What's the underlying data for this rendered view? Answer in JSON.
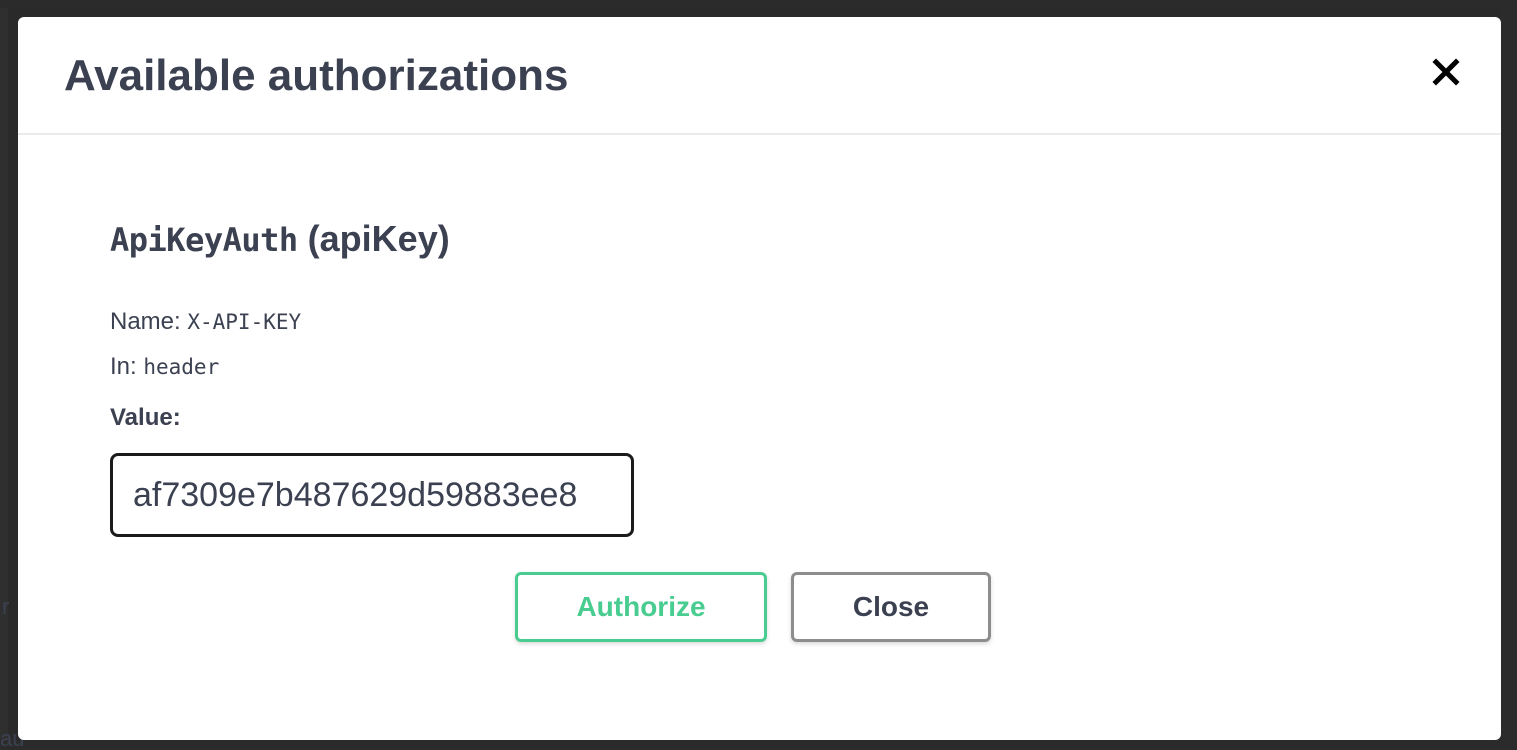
{
  "modal": {
    "title": "Available authorizations",
    "close_icon": "close-icon"
  },
  "auth": {
    "scheme_name": "ApiKeyAuth",
    "scheme_type": "(apiKey)",
    "name_label": "Name:",
    "name_value": "X-API-KEY",
    "in_label": "In:",
    "in_value": "header",
    "value_label": "Value:",
    "value_input": "af7309e7b487629d59883ee8"
  },
  "buttons": {
    "authorize": "Authorize",
    "close": "Close"
  },
  "background": {
    "peek_text_bottom": "au",
    "peek_text_mid": "r"
  },
  "colors": {
    "accent_green": "#49cc90",
    "text_dark": "#3b4151",
    "backdrop": "#2a2a2a"
  }
}
